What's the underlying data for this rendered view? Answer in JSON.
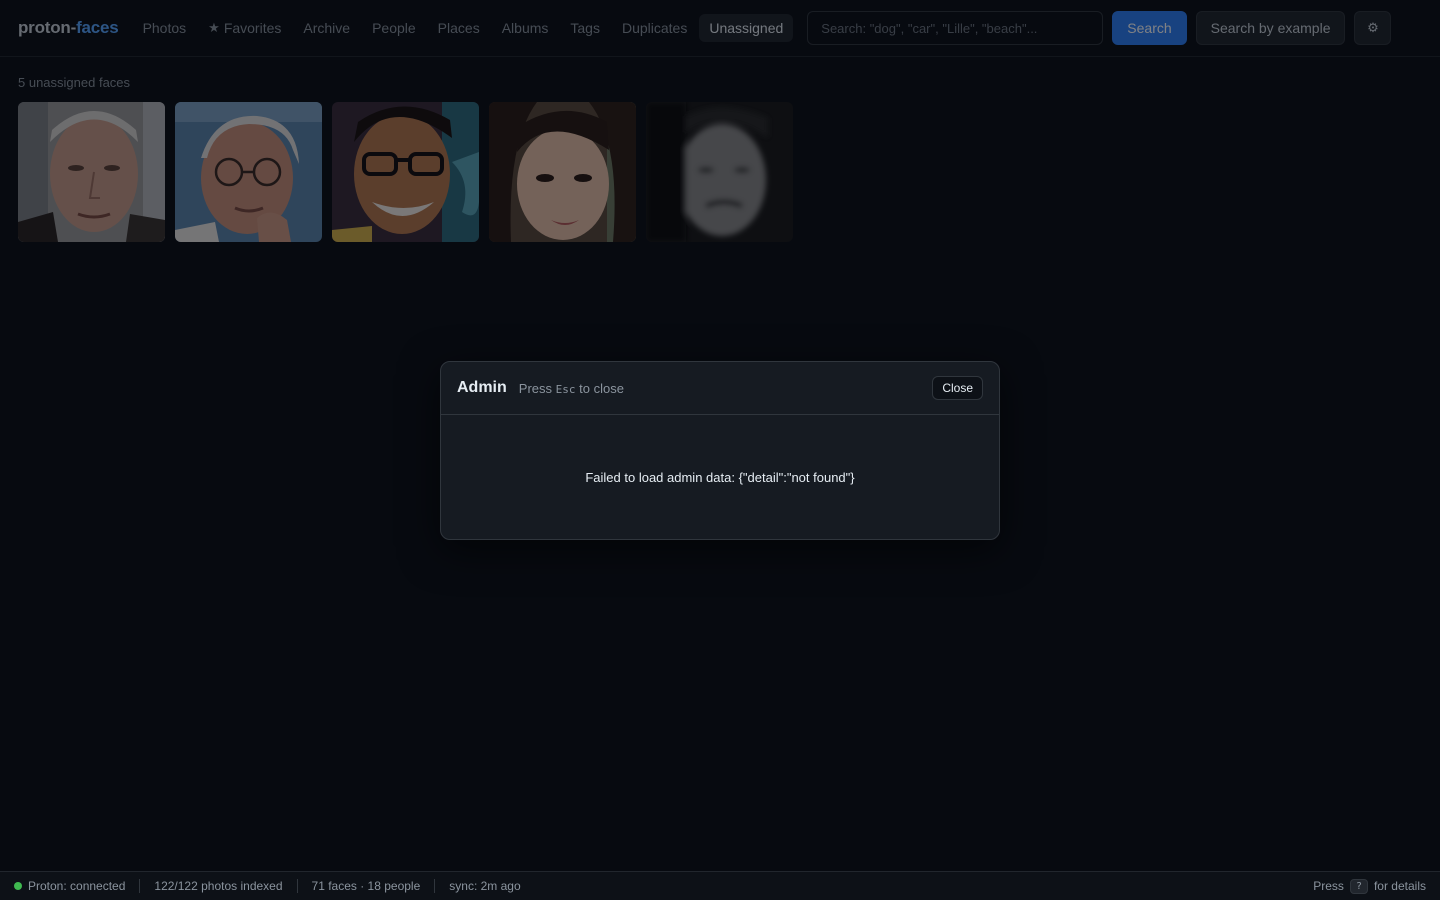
{
  "app": {
    "brand_part1": "proton-",
    "brand_part2": "faces"
  },
  "nav": {
    "items": [
      {
        "label": "Photos"
      },
      {
        "label": "Favorites",
        "icon": "star-icon"
      },
      {
        "label": "Archive"
      },
      {
        "label": "People"
      },
      {
        "label": "Places"
      },
      {
        "label": "Albums"
      },
      {
        "label": "Tags"
      },
      {
        "label": "Duplicates"
      },
      {
        "label": "Unassigned",
        "active": true
      }
    ]
  },
  "search": {
    "placeholder": "Search: \"dog\", \"car\", \"Lille\", \"beach\"...",
    "value": "",
    "search_label": "Search",
    "example_label": "Search by example",
    "settings_icon": "gear-icon"
  },
  "main": {
    "count_text": "5 unassigned faces",
    "faces": [
      {
        "id": "face-1"
      },
      {
        "id": "face-2"
      },
      {
        "id": "face-3"
      },
      {
        "id": "face-4"
      },
      {
        "id": "face-5"
      }
    ]
  },
  "modal": {
    "title": "Admin",
    "hint_pre": "Press",
    "hint_key": "Esc",
    "hint_post": "to close",
    "close_label": "Close",
    "message": "Failed to load admin data: {\"detail\":\"not found\"}"
  },
  "status": {
    "connection": "Proton: connected",
    "indexed": "122/122 photos indexed",
    "faces_people": "71 faces · 18 people",
    "sync": "sync: 2m ago",
    "help_pre": "Press",
    "help_key": "?",
    "help_post": "for details"
  },
  "colors": {
    "accent": "#2f81f7",
    "brand_accent": "#58a6ff",
    "connected": "#3fb950"
  }
}
